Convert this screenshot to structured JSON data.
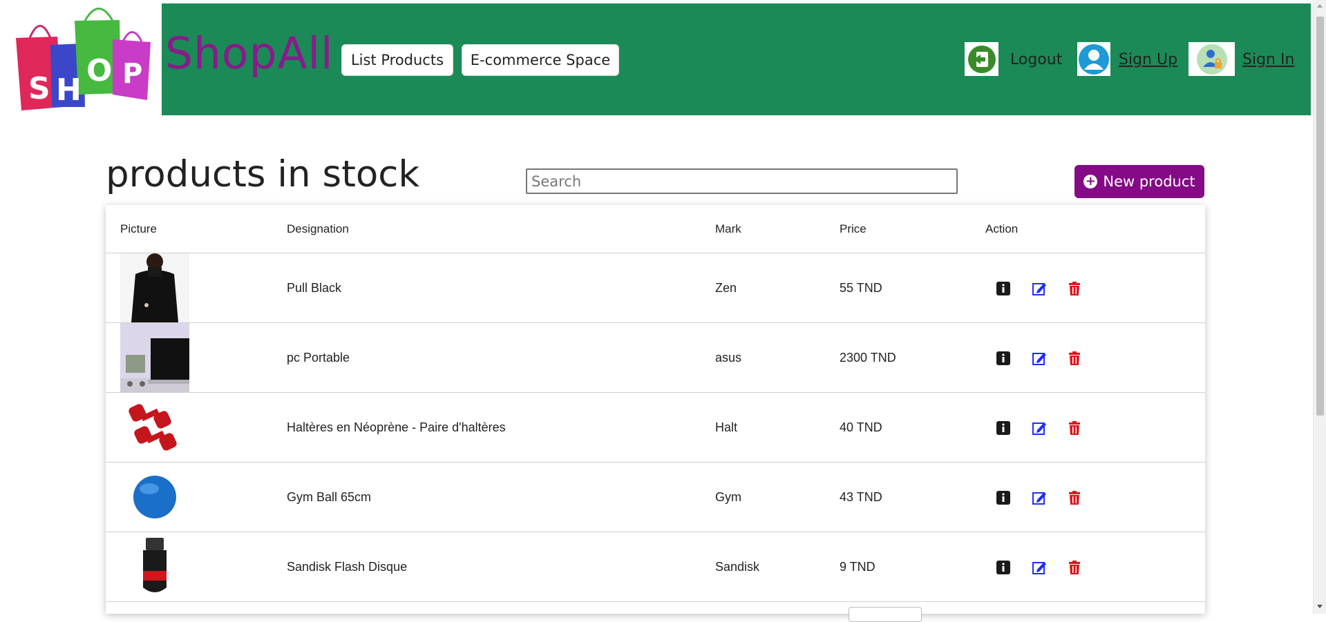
{
  "header": {
    "brand": "ShopAll",
    "logo_text": "SHOP",
    "nav": [
      {
        "label": "List Products"
      },
      {
        "label": "E-commerce Space"
      }
    ],
    "logout_label": "Logout",
    "signup_label": " Sign Up",
    "signin_label": " Sign In"
  },
  "main": {
    "title": "products in stock",
    "search_placeholder": "Search",
    "new_button_label": "New product"
  },
  "table": {
    "columns": [
      "Picture",
      "Designation",
      "Mark",
      "Price",
      "Action"
    ],
    "rows": [
      {
        "designation": "Pull Black",
        "mark": "Zen",
        "price": "55 TND",
        "image": "black-pullover-photo"
      },
      {
        "designation": "pc Portable",
        "mark": "asus",
        "price": "2300 TND",
        "image": "laptop-photo"
      },
      {
        "designation": "Haltères en Néoprène - Paire d'haltères",
        "mark": "Halt",
        "price": "40 TND",
        "image": "red-dumbbells-photo"
      },
      {
        "designation": "Gym Ball 65cm",
        "mark": "Gym",
        "price": "43 TND",
        "image": "blue-gym-ball-photo"
      },
      {
        "designation": "Sandisk Flash Disque",
        "mark": "Sandisk",
        "price": "9 TND",
        "image": "usb-flash-drive-photo"
      }
    ]
  },
  "colors": {
    "header_bg": "#1b8a56",
    "brand": "#8a1a8c",
    "new_button_bg": "#840a86",
    "info_icon": "#1a1a1a",
    "edit_icon": "#1d2dff",
    "delete_icon": "#e0151b"
  }
}
